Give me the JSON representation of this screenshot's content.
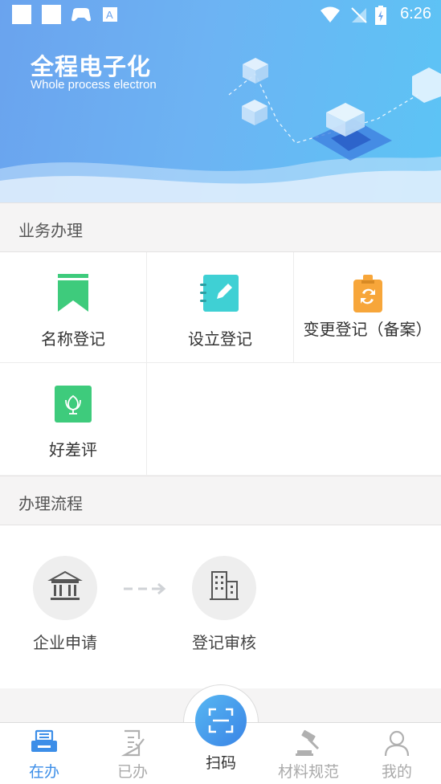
{
  "status_bar": {
    "time": "6:26"
  },
  "banner": {
    "title": "全程电子化",
    "subtitle": "Whole process electron"
  },
  "services": {
    "section_title": "业务办理",
    "items": [
      {
        "label": "名称登记",
        "icon": "bookmark-icon",
        "color": "#3ecb7c"
      },
      {
        "label": "设立登记",
        "icon": "notebook-edit-icon",
        "color": "#3fd0d4"
      },
      {
        "label": "变更登记（备案）",
        "icon": "clipboard-refresh-icon",
        "color": "#f7a63a"
      },
      {
        "label": "好差评",
        "icon": "flower-icon",
        "color": "#3ecb7c"
      }
    ]
  },
  "process": {
    "section_title": "办理流程",
    "steps": [
      {
        "label": "企业申请",
        "icon": "bank-icon"
      },
      {
        "label": "登记审核",
        "icon": "building-icon"
      }
    ]
  },
  "bottom_nav": {
    "items": [
      {
        "label": "在办",
        "icon": "printer-icon",
        "active": true
      },
      {
        "label": "已办",
        "icon": "document-check-icon",
        "active": false
      },
      {
        "label": "扫码",
        "icon": "scan-icon",
        "active": false
      },
      {
        "label": "材料规范",
        "icon": "gavel-icon",
        "active": false
      },
      {
        "label": "我的",
        "icon": "user-icon",
        "active": false
      }
    ]
  },
  "colors": {
    "accent": "#3c8ee8",
    "banner_start": "#6aa3ee",
    "banner_end": "#5cc4f5"
  }
}
